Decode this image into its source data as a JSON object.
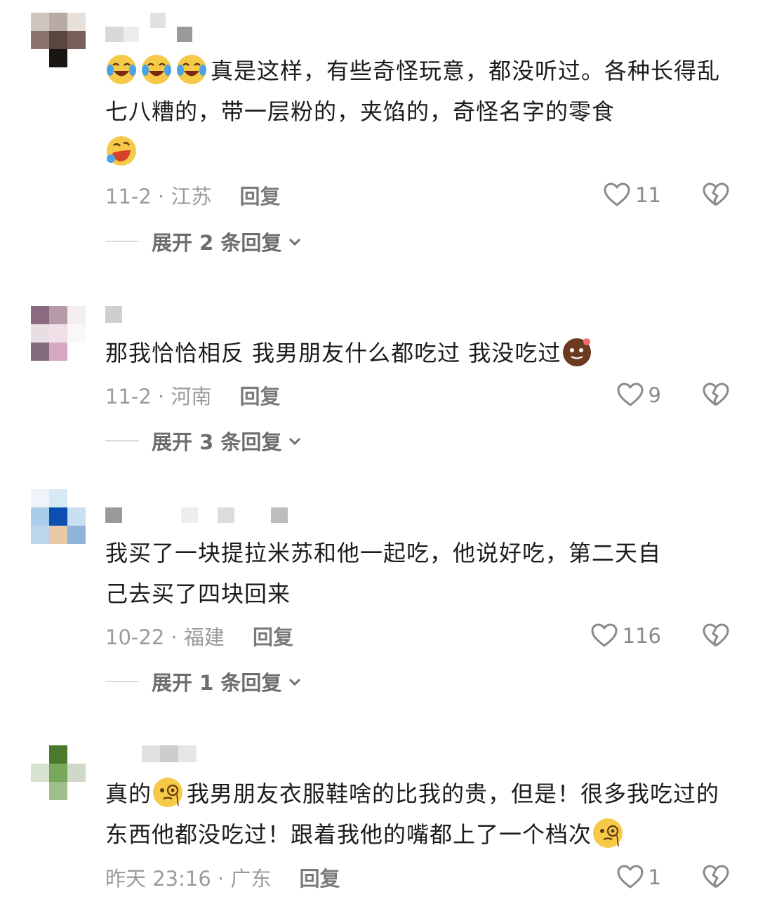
{
  "comments": [
    {
      "text_before": "真是这样，有些奇怪玩意，都没听过。各种长得乱七八糟的，带一层粉的，夹馅的，奇怪名字的零食",
      "date_location": "11-2 · 江苏",
      "reply_label": "回复",
      "likes": "11",
      "expand_label": "展开 2 条回复"
    },
    {
      "text_before": "那我恰恰相反 我男朋友什么都吃过 我没吃过",
      "date_location": "11-2 · 河南",
      "reply_label": "回复",
      "likes": "9",
      "expand_label": "展开 3 条回复"
    },
    {
      "text_line1": "我买了一块提拉米苏和他一起吃，他说好吃，第二天自",
      "text_line2": "己去买了四块回来",
      "date_location": "10-22 · 福建",
      "reply_label": "回复",
      "likes": "116",
      "expand_label": "展开 1 条回复"
    },
    {
      "text_start": "真的",
      "text_mid": "我男朋友衣服鞋啥的比我的贵，但是！很多我吃过的东西他都没吃过！跟着我他的嘴都上了一个档次",
      "date_location": "昨天 23:16 · 广东",
      "reply_label": "回复",
      "likes": "1"
    }
  ],
  "icons": {
    "like": "heart-outline-icon",
    "dislike": "broken-heart-icon",
    "expand": "chevron-down-icon",
    "emoji_cry": "tears-of-joy-emoji-icon",
    "emoji_rofl": "rolling-laughing-emoji-icon",
    "emoji_brown": "brown-face-emoji-icon",
    "emoji_monocle": "monocle-face-emoji-icon"
  },
  "colors": {
    "text": "#1c1c1c",
    "meta": "#9b9b9b",
    "icon": "#7a7a7a"
  }
}
